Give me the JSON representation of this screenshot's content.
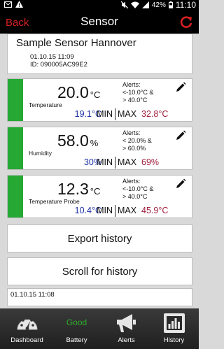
{
  "status_bar": {
    "battery_percent": "42%",
    "time": "11:10",
    "icons": [
      "email-icon",
      "warning-icon",
      "mute-icon",
      "wifi-icon",
      "signal-icon",
      "battery-icon"
    ]
  },
  "header": {
    "back_label": "Back",
    "title": "Sensor",
    "refresh_icon": "refresh-icon"
  },
  "device": {
    "name": "Sample Sensor Hannover",
    "date": "01.10.15 11:09",
    "id": "ID: 090005AC99E2"
  },
  "sensors": [
    {
      "value": "20.0",
      "unit": "°C",
      "label": "Temperature",
      "alerts": [
        "Alerts:",
        "<-10.0°C &",
        "> 40.0°C"
      ],
      "min_value": "19.1°C",
      "min_label": "MIN",
      "max_label": "MAX",
      "max_value": "32.8°C"
    },
    {
      "value": "58.0",
      "unit": "%",
      "label": "Humidity",
      "alerts": [
        "Alerts:",
        "< 20.0% &",
        "> 60.0%"
      ],
      "min_value": "30%",
      "min_label": "MIN",
      "max_label": "MAX",
      "max_value": "69%"
    },
    {
      "value": "12.3",
      "unit": "°C",
      "label": "Temperature Probe",
      "alerts": [
        "Alerts:",
        "<-10.0°C &",
        "> 40.0°C"
      ],
      "min_value": "10.4°C",
      "min_label": "MIN",
      "max_label": "MAX",
      "max_value": "45.9°C"
    }
  ],
  "actions": {
    "export_label": "Export history",
    "scroll_label": "Scroll for history"
  },
  "history": {
    "first_entry": "01.10.15 11:08"
  },
  "bottom_nav": {
    "items": [
      {
        "label": "Dashboard",
        "icon": "speedometer-icon"
      },
      {
        "label": "Battery",
        "state": "Good"
      },
      {
        "label": "Alerts",
        "icon": "megaphone-icon"
      },
      {
        "label": "History",
        "icon": "bar-chart-icon"
      }
    ]
  },
  "colors": {
    "ok_green": "#25a934",
    "min_blue": "#1c30a8",
    "max_red": "#a0203e",
    "header_red": "#d72020",
    "battery_good": "#2fae2c"
  }
}
